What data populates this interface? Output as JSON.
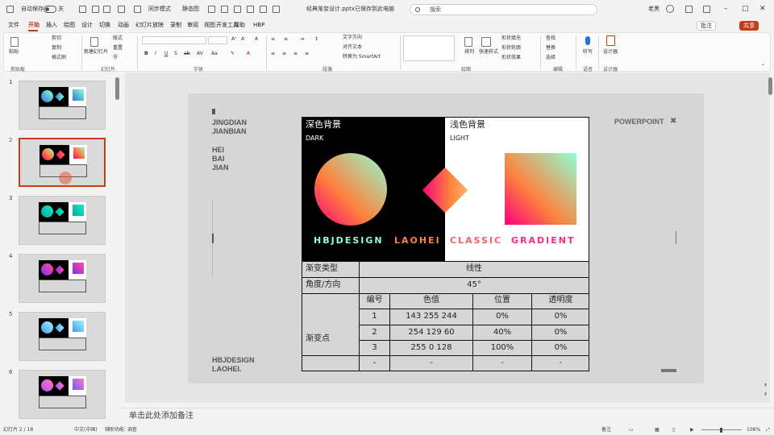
{
  "titlebar": {
    "autosave": "自动保存",
    "autosave_state": "关",
    "quick1": "同步模式",
    "quick2": "静态图",
    "filename": "经典渐变设计.pptx",
    "saved_status": "已保存到此电脑",
    "search_placeholder": "搜索",
    "user": "老黑"
  },
  "tabs": [
    "文件",
    "开始",
    "插入",
    "绘图",
    "设计",
    "切换",
    "动画",
    "幻灯片放映",
    "录制",
    "审阅",
    "视图",
    "开发工具",
    "帮助",
    "HBP"
  ],
  "header_buttons": {
    "comments": "批注",
    "share": "共享"
  },
  "ribbon": {
    "groups": [
      "剪贴板",
      "幻灯片",
      "字体",
      "段落",
      "绘图",
      "编辑",
      "语音",
      "设计器"
    ],
    "clipboard": {
      "paste": "粘贴",
      "cut": "剪切",
      "copy": "复制",
      "format_painter": "格式刷"
    },
    "slides": {
      "new_slide": "新建幻灯片",
      "layout": "版式",
      "reset": "重置",
      "section": "节"
    },
    "paragraph": {
      "text_direction": "文字方向",
      "align_text": "对齐文本",
      "smartart": "转换为 SmartArt"
    },
    "drawing": {
      "arrange": "排列",
      "quick_styles": "快速样式",
      "fill": "形状填充",
      "outline": "形状轮廓",
      "effects": "形状效果"
    },
    "editing": {
      "find": "查找",
      "replace": "替换",
      "select": "选择"
    },
    "voice": {
      "dictate": "听写"
    },
    "designer": {
      "designer": "设计器"
    }
  },
  "slide_panel": {
    "numbers": [
      "1",
      "2",
      "3",
      "4",
      "5",
      "6"
    ]
  },
  "slide": {
    "left_title_1": "JINGDIAN",
    "left_title_2": "JIANBIAN",
    "left_words": [
      "HEI",
      "BAI",
      "JIAN"
    ],
    "brand_1": "HBJDESIGN",
    "brand_2": "LAOHEI.",
    "tag": "POWERPOINT",
    "tag_icon": "close-icon",
    "dark_label": "深色背景",
    "dark_sub": "DARK",
    "light_label": "浅色背景",
    "light_sub": "LIGHT",
    "banner_1": "HBJDESIGN",
    "banner_2": "LAOHEI",
    "banner_3": "CLASSIC",
    "banner_4": "GRADIENT",
    "colors": {
      "pink": "#ff0080",
      "orange": "#fe813c",
      "cyan": "#8fffd4"
    }
  },
  "table": {
    "type_label": "渐变类型",
    "type_value": "线性",
    "angle_label": "角度/方向",
    "angle_value": "45°",
    "stops_label": "渐变点",
    "headers": [
      "编号",
      "色值",
      "位置",
      "透明度"
    ],
    "rows": [
      [
        "1",
        "143 255 244",
        "0%",
        "0%"
      ],
      [
        "2",
        "254 129 60",
        "40%",
        "0%"
      ],
      [
        "3",
        "255 0 128",
        "100%",
        "0%"
      ],
      [
        "-",
        "-",
        "-",
        "-"
      ]
    ]
  },
  "notes_placeholder": "单击此处添加备注",
  "status": {
    "slide_info": "幻灯片 2 / 18",
    "language": "中文(中国)",
    "accessibility": "辅助功能: 调查",
    "notes": "备注",
    "zoom": "108%"
  }
}
